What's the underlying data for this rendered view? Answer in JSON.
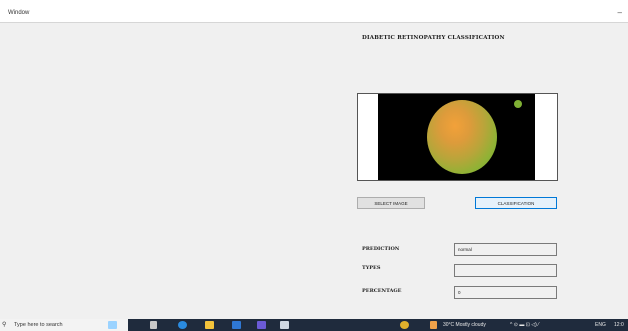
{
  "window": {
    "title": "Window",
    "minimize_glyph": "–"
  },
  "heading": "DIABETIC RETINOPATHY CLASSIFICATION",
  "buttons": {
    "select_image": "SELECT IMAGE",
    "classification": "CLASSIFICATION"
  },
  "fields": {
    "prediction": {
      "label": "PREDICTION",
      "value": "normal"
    },
    "types": {
      "label": "TYPES",
      "value": ""
    },
    "percentage": {
      "label": "PERCENTAGE",
      "value": "0"
    }
  },
  "taskbar": {
    "search_placeholder": "Type here to search",
    "weather": "30°C  Mostly cloudy",
    "language": "ENG",
    "time": "12:0"
  },
  "icons": [
    "search-icon",
    "task-view-icon",
    "edge-icon",
    "file-explorer-icon",
    "mail-icon",
    "visual-studio-icon",
    "python-icon",
    "chrome-icon",
    "weather-icon"
  ],
  "colors": {
    "accent": "#0078d7",
    "taskbar": "#1f2b3d",
    "client_bg": "#f0f0f0"
  }
}
